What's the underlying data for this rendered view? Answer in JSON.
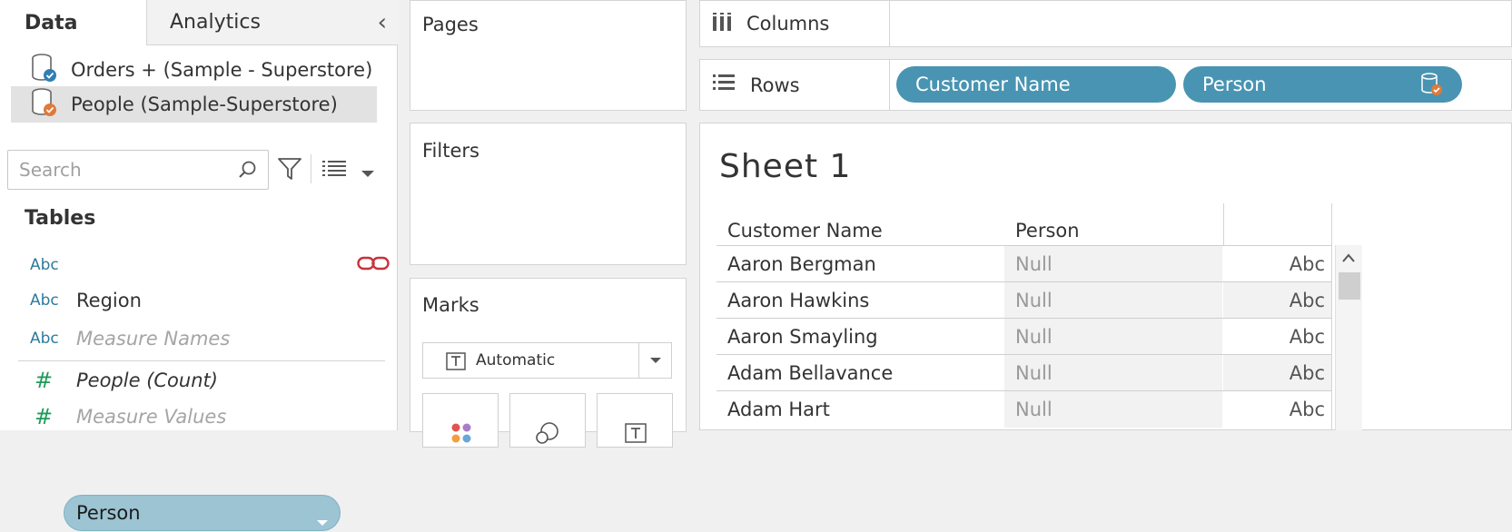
{
  "data_pane": {
    "tabs": {
      "data": "Data",
      "analytics": "Analytics"
    },
    "data_sources": [
      {
        "name": "Orders + (Sample - Superstore)",
        "badge_color": "#2f7fb5"
      },
      {
        "name": "People (Sample-Superstore)",
        "badge_color": "#e07a3a",
        "selected": true
      }
    ],
    "search_placeholder": "Search",
    "tables_heading": "Tables",
    "fields": [
      {
        "type": "Abc",
        "name": "Person",
        "selected": true
      },
      {
        "type": "Abc",
        "name": "Region"
      },
      {
        "type": "Abc",
        "name": "Measure Names",
        "style": "italic-grey"
      },
      {
        "type": "#",
        "name": "People (Count)",
        "style": "italic"
      },
      {
        "type": "#",
        "name": "Measure Values",
        "style": "italic-grey"
      }
    ]
  },
  "shelves": {
    "pages": "Pages",
    "filters": "Filters",
    "marks": {
      "title": "Marks",
      "mark_type": "Automatic"
    },
    "columns": "Columns",
    "rows": {
      "label": "Rows",
      "pills": [
        "Customer Name",
        "Person"
      ]
    }
  },
  "sheet": {
    "title": "Sheet 1",
    "columns": [
      "Customer Name",
      "Person"
    ],
    "rows": [
      {
        "name": "Aaron Bergman",
        "person": "Null",
        "type": "Abc"
      },
      {
        "name": "Aaron Hawkins",
        "person": "Null",
        "type": "Abc"
      },
      {
        "name": "Aaron Smayling",
        "person": "Null",
        "type": "Abc"
      },
      {
        "name": "Adam Bellavance",
        "person": "Null",
        "type": "Abc"
      },
      {
        "name": "Adam Hart",
        "person": "Null",
        "type": "Abc"
      }
    ]
  },
  "colors": {
    "pill_blue": "#4994b2",
    "pill_light_blue": "#9cc4d3",
    "abc_blue": "#2d7a9b",
    "measure_green": "#1f9a5a",
    "link_red": "#c8323c"
  }
}
